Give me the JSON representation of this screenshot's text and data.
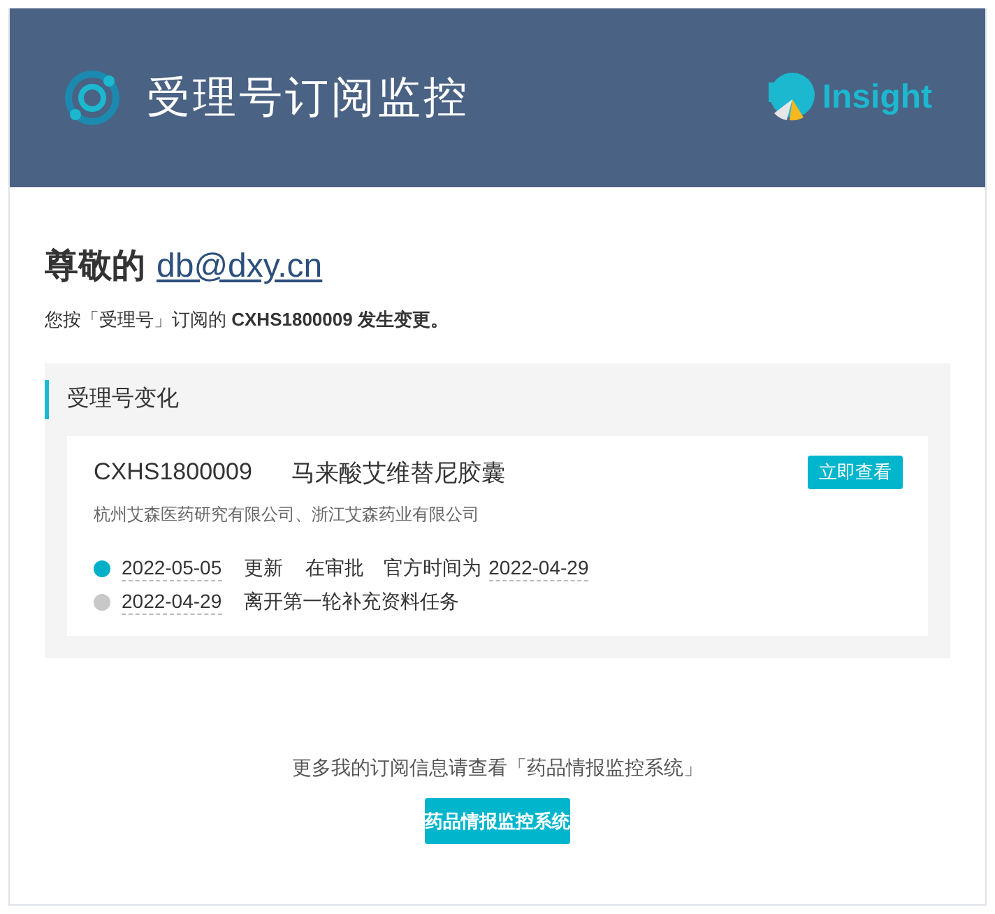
{
  "header": {
    "title": "受理号订阅监控",
    "brand": "Insight"
  },
  "greeting": {
    "salutation": "尊敬的",
    "email": "db@dxy.cn"
  },
  "notice": "您按「受理号」订阅的 **CXHS1800009 发生变更。**",
  "section": {
    "title": "受理号变化",
    "item": {
      "code": "CXHS1800009",
      "name": "马来酸艾维替尼胶囊",
      "companies": "杭州艾森医药研究有限公司、浙江艾森药业有限公司",
      "button": "立即查看",
      "events": [
        {
          "color": "#00b0c8",
          "date": "2022-05-05",
          "parts": [
            "更新",
            "在审批"
          ],
          "official_label": "官方时间为",
          "official_date": "2022-04-29"
        },
        {
          "color": "#c8c8c8",
          "date": "2022-04-29",
          "parts": [
            "离开第一轮补充资料任务"
          ]
        }
      ]
    }
  },
  "footer": {
    "text": "更多我的订阅信息请查看「药品情报监控系统」",
    "button": "药品情报监控系统"
  }
}
